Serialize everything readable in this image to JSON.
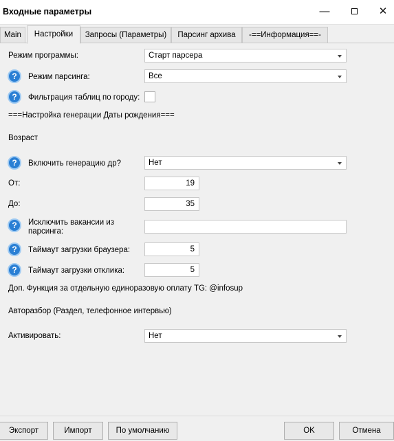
{
  "window": {
    "title": "Входные параметры"
  },
  "tabs": [
    {
      "label": "Main"
    },
    {
      "label": "Настройки"
    },
    {
      "label": "Запросы (Параметры)"
    },
    {
      "label": "Парсинг архива"
    },
    {
      "label": "-==Информация==-"
    }
  ],
  "active_tab": "Настройки",
  "form": {
    "program_mode": {
      "label": "Режим программы:",
      "value": "Старт парсера"
    },
    "parse_mode": {
      "label": "Режим парсинга:",
      "value": "Все"
    },
    "city_filter": {
      "label": "Фильтрация таблиц по городу:",
      "checked": false
    },
    "birthdate_header": "===Настройка генерации Даты рождения===",
    "age_header": "Возраст",
    "enable_generation": {
      "label": "Включить генерацию др?",
      "value": "Нет"
    },
    "from": {
      "label": "От:",
      "value": "19"
    },
    "to": {
      "label": "До:",
      "value": "35"
    },
    "exclude_vacancies": {
      "label_line1": "Исключить вакансии из",
      "label_line2": "парсинга:",
      "value": ""
    },
    "browser_timeout": {
      "label": "Таймаут загрузки браузера:",
      "value": "5"
    },
    "response_timeout": {
      "label": "Таймаут загрузки отклика:",
      "value": "5"
    },
    "extra_info": "Доп. Функция за отдельную единоразовую оплату TG: @infosup",
    "autoparse_header": "Авторазбор (Раздел, телефонное интервью)",
    "activate": {
      "label": "Активировать:",
      "value": "Нет"
    }
  },
  "help_glyph": "?",
  "buttons": {
    "export": "Экспорт",
    "import": "Импорт",
    "defaults": "По умолчанию",
    "ok": "OK",
    "cancel": "Отмена"
  },
  "window_controls": {
    "minimize": "—",
    "close": "✕"
  },
  "icons": [
    "help-icon",
    "dropdown-arrow-icon",
    "minimize-icon",
    "maximize-icon",
    "close-icon"
  ]
}
